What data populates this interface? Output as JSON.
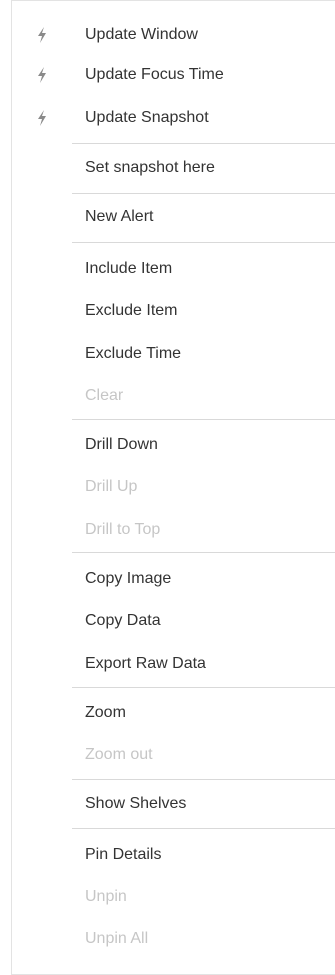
{
  "menu": {
    "items": [
      {
        "label": "Update Window",
        "icon": "lightning-bolt-icon",
        "disabled": false
      },
      {
        "label": "Update Focus Time",
        "icon": "lightning-bolt-icon",
        "disabled": false
      },
      {
        "label": "Update Snapshot",
        "icon": "lightning-bolt-icon",
        "disabled": false
      },
      {
        "label": "Set snapshot here",
        "disabled": false
      },
      {
        "label": "New Alert",
        "disabled": false
      },
      {
        "label": "Include Item",
        "disabled": false
      },
      {
        "label": "Exclude Item",
        "disabled": false
      },
      {
        "label": "Exclude Time",
        "disabled": false
      },
      {
        "label": "Clear",
        "disabled": true
      },
      {
        "label": "Drill Down",
        "disabled": false
      },
      {
        "label": "Drill Up",
        "disabled": true
      },
      {
        "label": "Drill to Top",
        "disabled": true
      },
      {
        "label": "Copy Image",
        "disabled": false
      },
      {
        "label": "Copy Data",
        "disabled": false
      },
      {
        "label": "Export Raw Data",
        "disabled": false
      },
      {
        "label": "Zoom",
        "disabled": false
      },
      {
        "label": "Zoom out",
        "disabled": true
      },
      {
        "label": "Show Shelves",
        "disabled": false
      },
      {
        "label": "Pin Details",
        "disabled": false
      },
      {
        "label": "Unpin",
        "disabled": true
      },
      {
        "label": "Unpin All",
        "disabled": true
      }
    ]
  },
  "colors": {
    "text": "#333333",
    "disabled_text": "#c6c6c6",
    "icon": "#8a8a8a",
    "separator": "#d9d9d9"
  }
}
